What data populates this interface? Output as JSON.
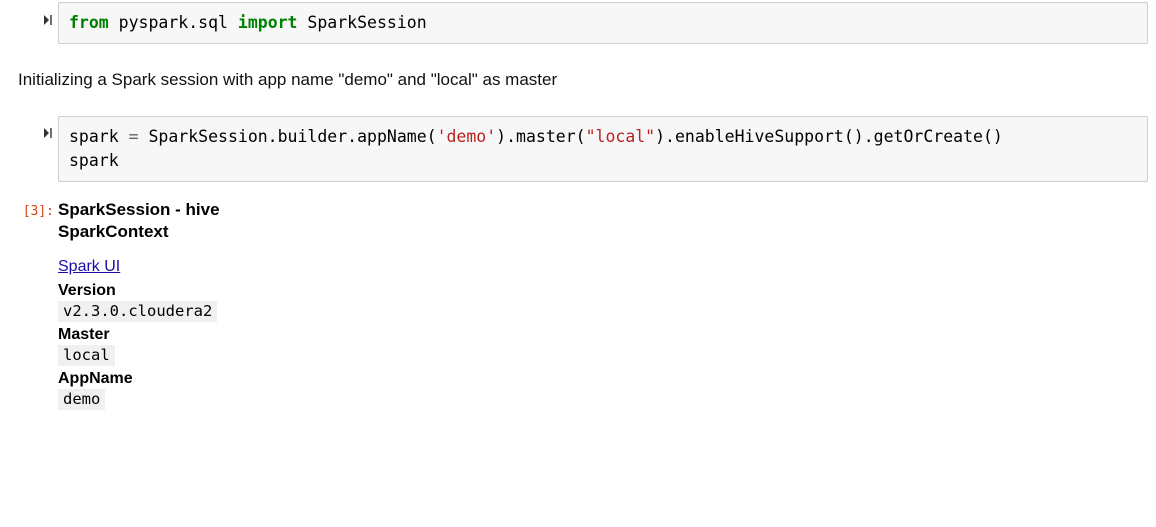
{
  "cells": {
    "c1": {
      "code": {
        "kw_from": "from",
        "mod1": " pyspark.sql ",
        "kw_import": "import",
        "mod2": " SparkSession"
      }
    },
    "md1": {
      "text": "Initializing a Spark session with app name \"demo\" and \"local\" as master"
    },
    "c2": {
      "code": {
        "line1_a": "spark ",
        "line1_eq": "=",
        "line1_b": " SparkSession.builder.appName(",
        "line1_s1": "'demo'",
        "line1_c": ").master(",
        "line1_s2": "\"local\"",
        "line1_d": ").enableHiveSupport().getOrCreate()",
        "line2": "spark"
      }
    },
    "out1": {
      "prompt": "[3]:",
      "title1": "SparkSession - hive",
      "title2": "SparkContext",
      "link": "Spark UI",
      "version_label": "Version",
      "version_value": "v2.3.0.cloudera2",
      "master_label": "Master",
      "master_value": "local",
      "appname_label": "AppName",
      "appname_value": "demo"
    }
  }
}
